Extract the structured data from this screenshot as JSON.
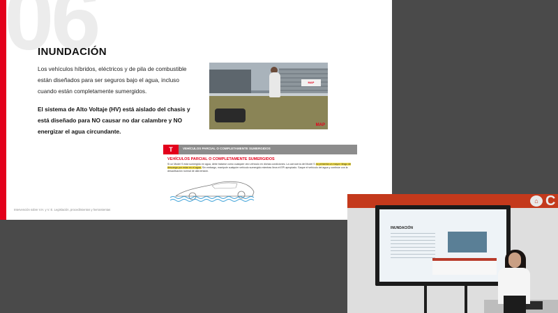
{
  "slide": {
    "number": "06",
    "title": "INUNDACIÓN",
    "paragraph1": "Los vehículos híbridos, eléctricos y de pila de combustible están diseñados para ser seguros bajo el agua, incluso cuando están completamente sumergidos.",
    "paragraph2": "El sistema de Alto Voltaje (HV) está aislado del chasis y está diseñado para NO causar no dar calambre y NO energizar el agua circundante.",
    "photo_logo": "MAP",
    "photo_sign": "MAP",
    "footer": "Intervención sobre V.H. y V. E. Legislación, procedimientos y herramientas"
  },
  "manual": {
    "logo": "T",
    "header": "VEHÍCULOS PARCIAL O COMPLETAMENTE SUMERGIDOS",
    "subtitle": "VEHÍCULOS PARCIAL O COMPLETAMENTE SUMERGIDOS",
    "text_before": "Si un Model S está sumergido en agua, debe tratarse como cualquier otro vehículo en dichas condiciones. La carrocería del Model S ",
    "text_highlight": "no presenta un mayor riesgo de descarga por estar en el agua.",
    "text_after": " Sin embargo, manipule cualquier vehículo sumergido mientras lleva el EPI apropiado. Saque el vehículo del agua y continúe con la desactivación normal de alta tensión."
  },
  "webcam": {
    "logo_letter": "C",
    "screen_title": "INUNDACIÓN"
  },
  "colors": {
    "accent_red": "#e3001b",
    "highlight_yellow": "#f4e04d",
    "background": "#4a4a4a"
  }
}
